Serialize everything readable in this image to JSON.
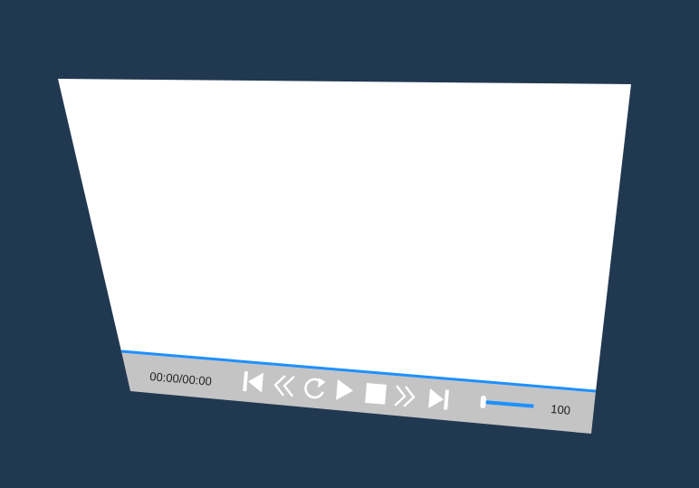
{
  "player": {
    "time_display": "00:00/00:00",
    "volume_value": "100",
    "progress_fraction": 1.0,
    "volume_fraction": 1.0,
    "colors": {
      "background": "#213851",
      "video_area": "#ffffff",
      "control_bar": "#c4c4c4",
      "accent": "#1e90ff",
      "icons": "#ffffff"
    },
    "controls": [
      "skip-to-start-icon",
      "rewind-icon",
      "replay-icon",
      "play-icon",
      "stop-icon",
      "fast-forward-icon",
      "skip-to-end-icon"
    ]
  }
}
